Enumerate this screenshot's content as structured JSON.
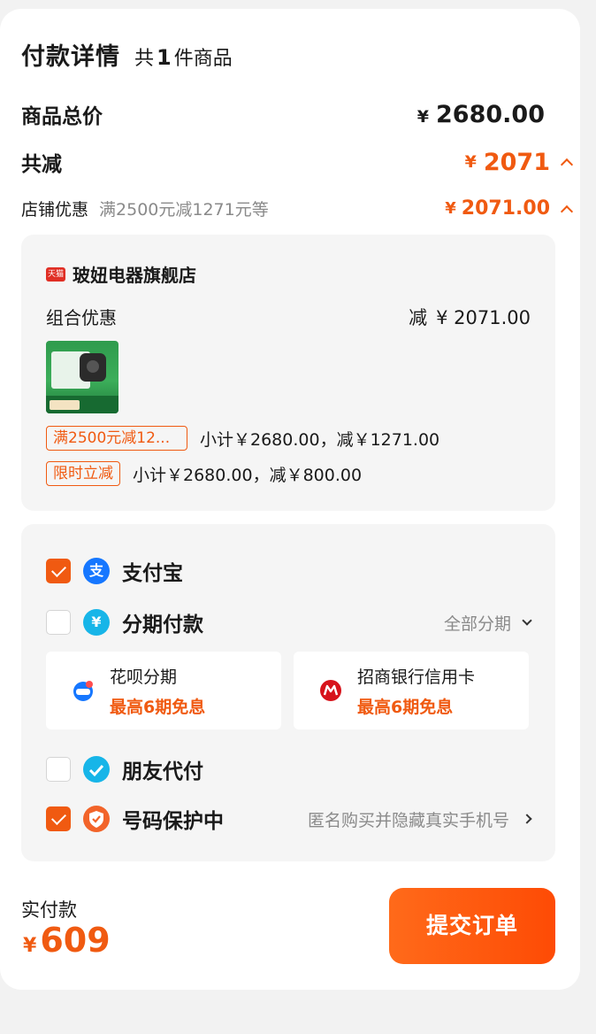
{
  "header": {
    "title": "付款详情",
    "count_pre": "共",
    "count_num": "1",
    "count_post": "件商品"
  },
  "summary": {
    "total_label": "商品总价",
    "currency": "¥",
    "total_value": "2680.00",
    "reduce_label": "共减",
    "reduce_value": "2071",
    "shop_discount_label": "店铺优惠",
    "shop_discount_desc": "满2500元减1271元等",
    "shop_discount_value": "2071.00"
  },
  "store": {
    "badge": "天猫",
    "name": "玻妞电器旗舰店",
    "combo_label": "组合优惠",
    "combo_prefix": "减",
    "combo_value": "¥ 2071.00",
    "promos": [
      {
        "tag": "满2500元减12...",
        "text": "小计￥2680.00，减￥1271.00"
      },
      {
        "tag": "限时立减",
        "text": "小计￥2680.00，减￥800.00"
      }
    ]
  },
  "payment": {
    "alipay": {
      "label": "支付宝",
      "checked": true,
      "icon_glyph": "支"
    },
    "installment": {
      "label": "分期付款",
      "checked": false,
      "right": "全部分期",
      "icon_glyph": "¥"
    },
    "options": [
      {
        "name": "花呗分期",
        "sub": "最高6期免息"
      },
      {
        "name": "招商银行信用卡",
        "sub": "最高6期免息"
      }
    ],
    "friend": {
      "label": "朋友代付",
      "checked": false
    },
    "privacy": {
      "label": "号码保护中",
      "checked": true,
      "right": "匿名购买并隐藏真实手机号"
    }
  },
  "footer": {
    "paid_label": "实付款",
    "currency": "¥",
    "paid_value": "609",
    "submit": "提交订单"
  },
  "colors": {
    "accent": "#f05a11",
    "alipay_blue": "#1677ff",
    "installment_teal": "#17b5e8",
    "privacy_orange": "#f2642a"
  }
}
